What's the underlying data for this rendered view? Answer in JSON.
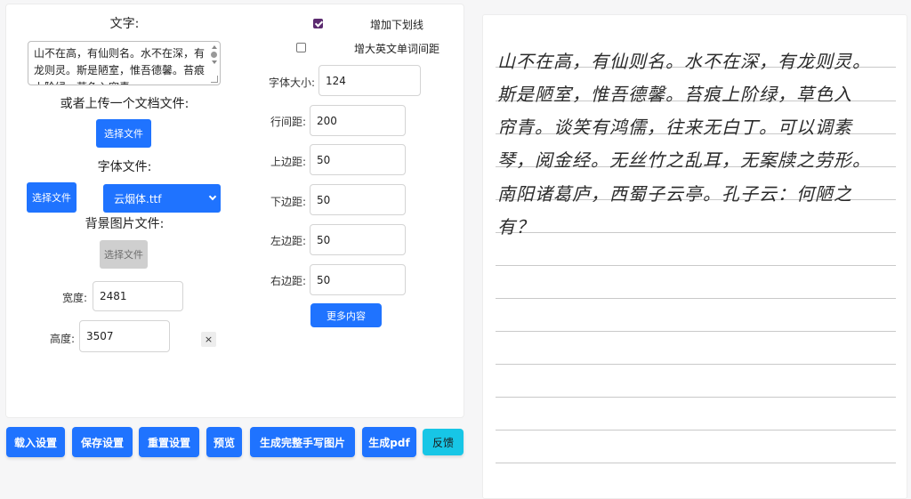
{
  "left": {
    "text_heading": "文字:",
    "textarea_value": "山不在高，有仙则名。水不在深，有龙则灵。斯是陋室，惟吾德馨。苔痕上阶绿，草色入帘青。",
    "upload_doc_heading": "或者上传一个文档文件:",
    "choose_file_label": "选择文件",
    "font_file_heading": "字体文件:",
    "font_select_value": "云烟体.ttf",
    "bg_image_heading": "背景图片文件:",
    "width_label": "宽度:",
    "width_value": "2481",
    "height_label": "高度:",
    "height_value": "3507",
    "close_glyph": "×"
  },
  "right": {
    "underline_label": "增加下划线",
    "underline_checked": true,
    "word_spacing_label": "增大英文单词间距",
    "word_spacing_checked": false,
    "font_size_label": "字体大小:",
    "font_size_value": "124",
    "line_spacing_label": "行间距:",
    "line_spacing_value": "200",
    "top_margin_label": "上边距:",
    "top_margin_value": "50",
    "bottom_margin_label": "下边距:",
    "bottom_margin_value": "50",
    "left_margin_label": "左边距:",
    "left_margin_value": "50",
    "right_margin_label": "右边距:",
    "right_margin_value": "50",
    "more_button": "更多内容"
  },
  "bottom_buttons": {
    "load": "载入设置",
    "save": "保存设置",
    "reset": "重置设置",
    "preview": "预览",
    "full_image": "生成完整手写图片",
    "pdf": "生成pdf",
    "feedback": "反馈"
  },
  "preview": {
    "lines": [
      "山不在高，有仙则名。水不在深，有龙则灵。",
      "斯是陋室，惟吾德馨。苔痕上阶绿，草色入",
      "帘青。谈笑有鸿儒，往来无白丁。可以调素",
      "琴，阅金经。无丝竹之乱耳，无案牍之劳形。",
      "南阳诸葛庐，西蜀子云亭。孔子云：何陋之",
      "有？"
    ]
  },
  "colors": {
    "primary": "#1f73ff",
    "feedback": "#17c6e6",
    "checkbox_checked": "#5b2a6f",
    "disabled": "#cfcfcf"
  }
}
